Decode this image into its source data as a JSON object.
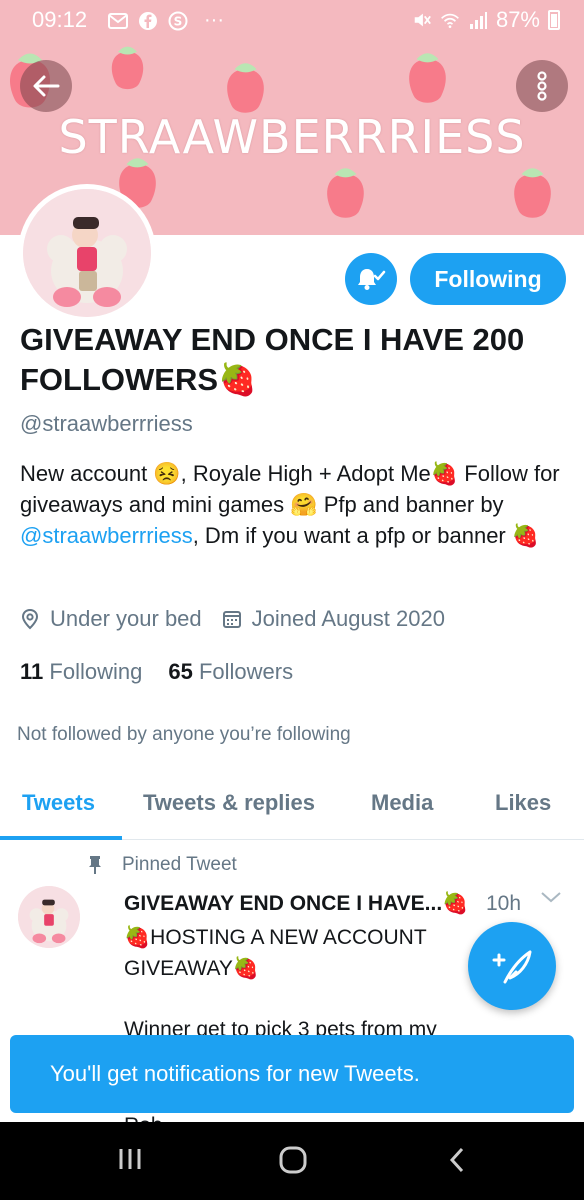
{
  "status_bar": {
    "time": "09:12",
    "battery": "87%",
    "notification_icons": [
      "mail-icon",
      "facebook-icon",
      "s-icon"
    ],
    "more": "···"
  },
  "banner": {
    "title": "STRAAWBERRRIESS",
    "background": "#f4b9bf"
  },
  "profile": {
    "display_name": "GIVEAWAY END ONCE I HAVE 200 FOLLOWERS🍓",
    "handle": "@straawberrriess",
    "follow_button": "Following",
    "bio": {
      "part1": "New account 😣, Royale High + Adopt Me🍓 Follow for giveaways and mini games 🤗 Pfp and banner by ",
      "link": "@straawberrriess",
      "part2": ", Dm if you want a pfp or banner 🍓"
    },
    "location": "Under your bed",
    "joined": "Joined August 2020",
    "following_count": "11",
    "following_label": "Following",
    "followers_count": "65",
    "followers_label": "Followers",
    "not_followed_text": "Not followed by anyone you’re following"
  },
  "tabs": [
    {
      "label": "Tweets",
      "active": true
    },
    {
      "label": "Tweets & replies",
      "active": false
    },
    {
      "label": "Media",
      "active": false
    },
    {
      "label": "Likes",
      "active": false
    }
  ],
  "tweet": {
    "pinned_label": "Pinned Tweet",
    "title": "GIVEAWAY END ONCE I HAVE...🍓",
    "time": "10h",
    "body_line1": "🍓HOSTING A NEW ACCOUNT GIVEAWAY🍓",
    "body_line2": "Winner get to pick 3 pets from my",
    "body_line3": "Rob"
  },
  "toast": {
    "text": "You'll get notifications for new Tweets."
  },
  "colors": {
    "accent": "#1da1f2",
    "banner": "#f4b9bf",
    "secondary_text": "#657786"
  }
}
